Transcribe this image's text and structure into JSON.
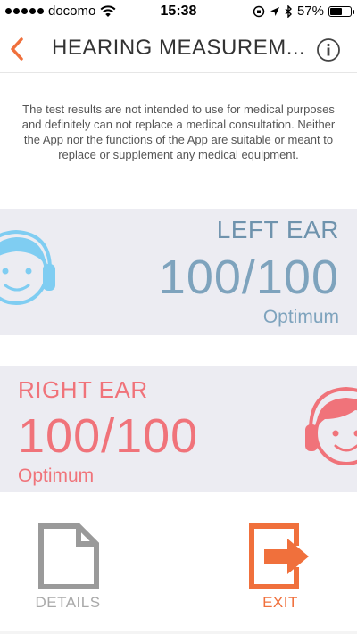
{
  "status_bar": {
    "carrier": "docomo",
    "time": "15:38",
    "battery": "57%",
    "battery_level": 0.57
  },
  "nav": {
    "title": "HEARING MEASUREM...",
    "back_icon": "chevron-left-icon",
    "info_icon": "info-icon"
  },
  "disclaimer": "The test results are not intended to use for medical purposes and definitely can not replace a medical consultation. Neither the App nor the functions of the App are suitable or meant to replace or supplement any medical equipment.",
  "left_ear": {
    "title": "LEFT EAR",
    "score": "100/100",
    "grade": "Optimum",
    "color": "#7ea3bd",
    "icon": "boy-headphones-icon"
  },
  "right_ear": {
    "title": "RIGHT EAR",
    "score": "100/100",
    "grade": "Optimum",
    "color": "#f0737a",
    "icon": "girl-headphones-icon"
  },
  "actions": {
    "details_label": "DETAILS",
    "details_icon": "document-icon",
    "exit_label": "EXIT",
    "exit_icon": "exit-arrow-icon",
    "accent": "#f0703c"
  }
}
